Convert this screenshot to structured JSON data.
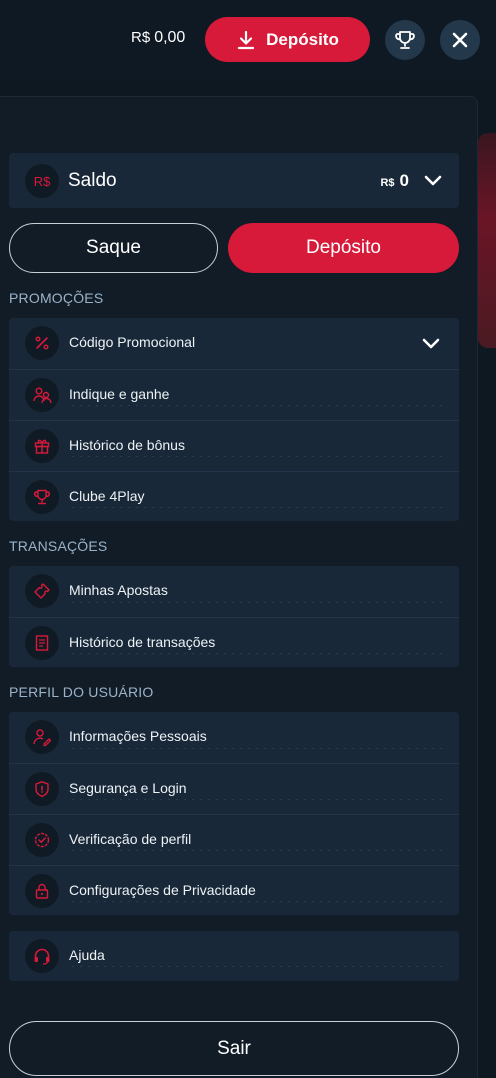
{
  "header": {
    "currency": "R$",
    "balance": "0,00",
    "deposit_label": "Depósito"
  },
  "saldo": {
    "icon_text": "R$",
    "label": "Saldo",
    "currency": "R$",
    "value": "0"
  },
  "actions": {
    "saque_label": "Saque",
    "deposito_label": "Depósito"
  },
  "sections": {
    "promocoes": {
      "title": "PROMOÇÕES",
      "items": [
        {
          "label": "Código Promocional",
          "icon": "percent-icon"
        },
        {
          "label": "Indique e ganhe",
          "icon": "users-icon"
        },
        {
          "label": "Histórico de bônus",
          "icon": "gift-icon"
        },
        {
          "label": "Clube 4Play",
          "icon": "trophy-icon"
        }
      ]
    },
    "transacoes": {
      "title": "TRANSAÇÕES",
      "items": [
        {
          "label": "Minhas Apostas",
          "icon": "ticket-icon"
        },
        {
          "label": "Histórico de transações",
          "icon": "receipt-icon"
        }
      ]
    },
    "perfil": {
      "title": "PERFIL DO USUÁRIO",
      "items": [
        {
          "label": "Informações Pessoais",
          "icon": "user-edit-icon"
        },
        {
          "label": "Segurança e Login",
          "icon": "shield-icon"
        },
        {
          "label": "Verificação de perfil",
          "icon": "verified-icon"
        },
        {
          "label": "Configurações de Privacidade",
          "icon": "lock-icon"
        }
      ]
    },
    "ajuda": {
      "items": [
        {
          "label": "Ajuda",
          "icon": "headset-icon"
        }
      ]
    }
  },
  "logout_label": "Sair",
  "colors": {
    "accent": "#d7193a",
    "background": "#0e1821",
    "card": "#182838",
    "section_title": "#9bb3c9"
  }
}
